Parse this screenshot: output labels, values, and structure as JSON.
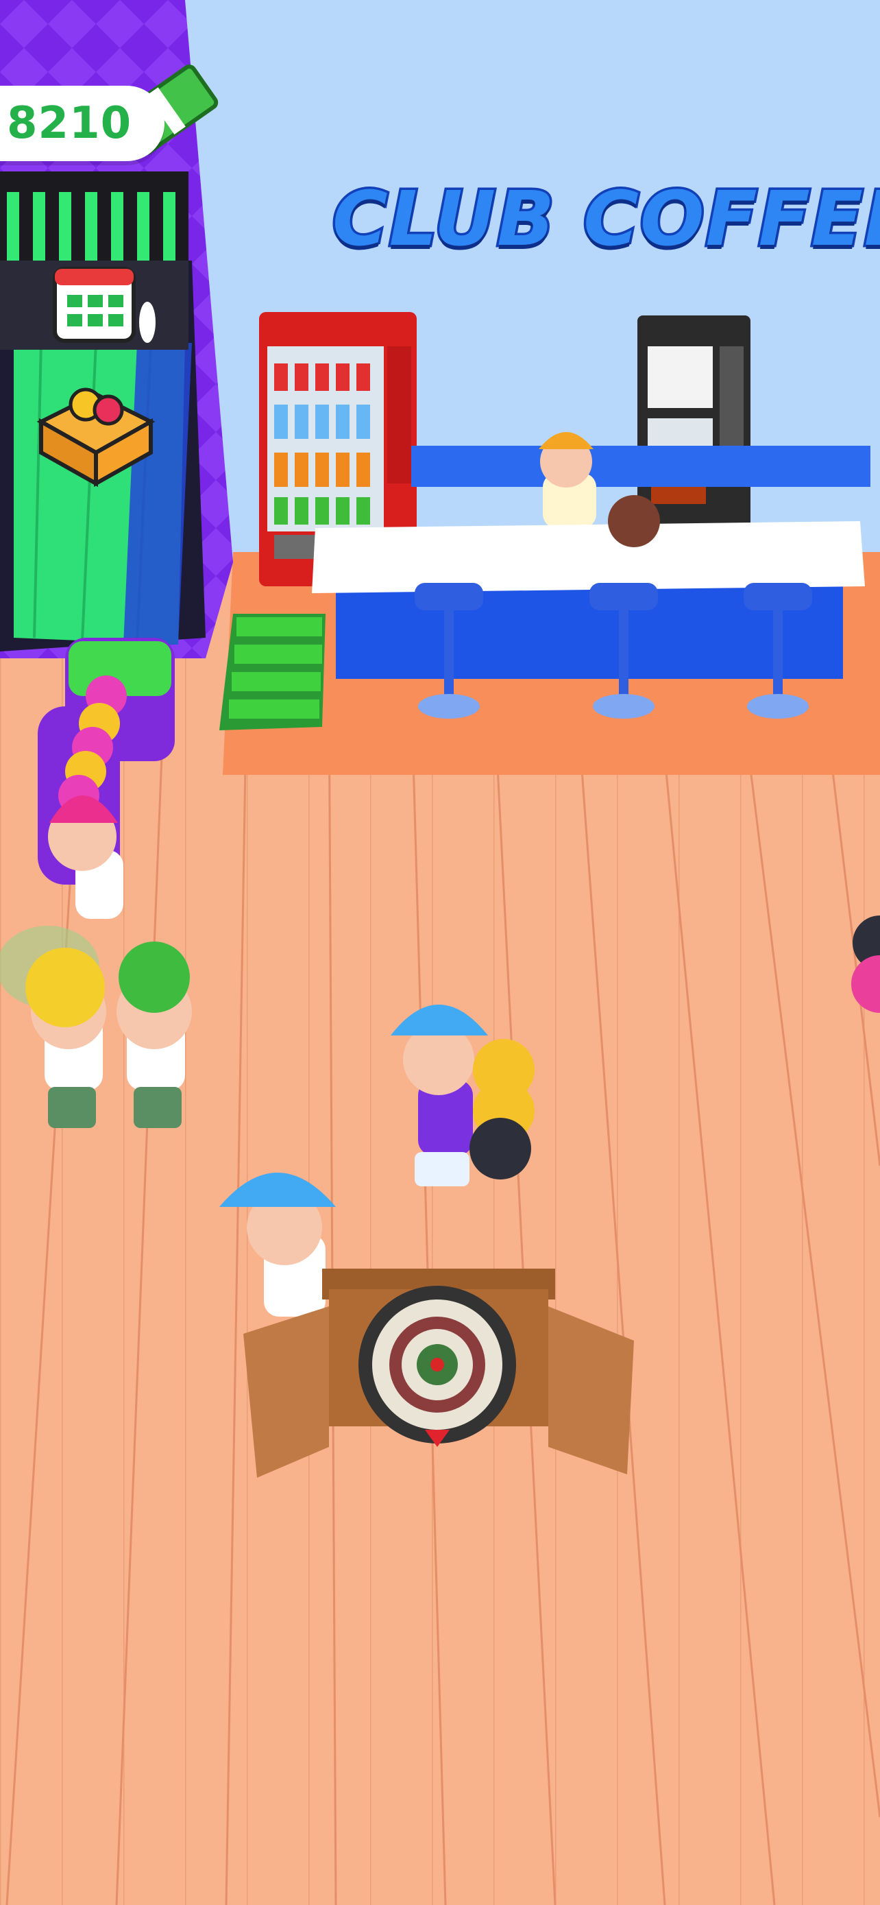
{
  "hud": {
    "money_value": "8210",
    "money_icon": "cash-stack-icon"
  },
  "sign": {
    "text": "CLUB COFFEE"
  },
  "icons": {
    "schedule": "calendar-icon",
    "ball_box": "bowling-ball-box-icon",
    "cash_pile": "cash-pile-icon"
  },
  "colors": {
    "floor": "#f9b28c",
    "wall": "#b7d8fb",
    "sign_fill": "#2e86f5",
    "money_green": "#24b14a",
    "counter_blue": "#1f55e6",
    "lane_green": "#2fe079",
    "purple_wall": "#7a26e8"
  }
}
